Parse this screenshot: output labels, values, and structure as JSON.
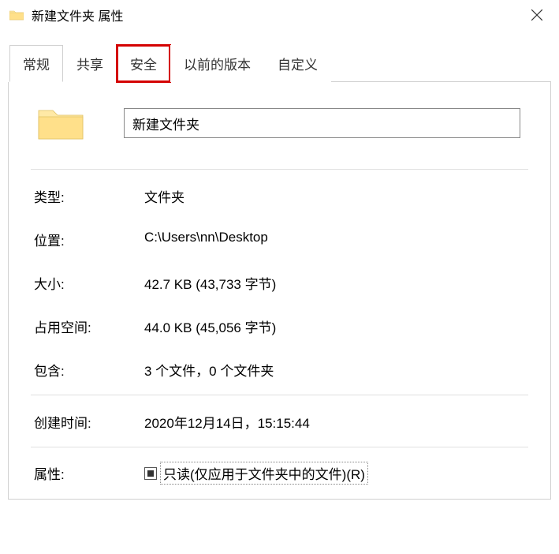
{
  "window": {
    "title": "新建文件夹 属性"
  },
  "tabs": {
    "general": "常规",
    "share": "共享",
    "security": "安全",
    "previous": "以前的版本",
    "custom": "自定义"
  },
  "name_field": {
    "value": "新建文件夹"
  },
  "props": {
    "type_label": "类型:",
    "type_value": "文件夹",
    "location_label": "位置:",
    "location_value": "C:\\Users\\nn\\Desktop",
    "size_label": "大小:",
    "size_value": "42.7 KB (43,733 字节)",
    "sizeondisk_label": "占用空间:",
    "sizeondisk_value": "44.0 KB (45,056 字节)",
    "contains_label": "包含:",
    "contains_value": "3 个文件，0 个文件夹",
    "created_label": "创建时间:",
    "created_value": "2020年12月14日，15:15:44",
    "attributes_label": "属性:",
    "readonly_label": "只读(仅应用于文件夹中的文件)(R)"
  }
}
